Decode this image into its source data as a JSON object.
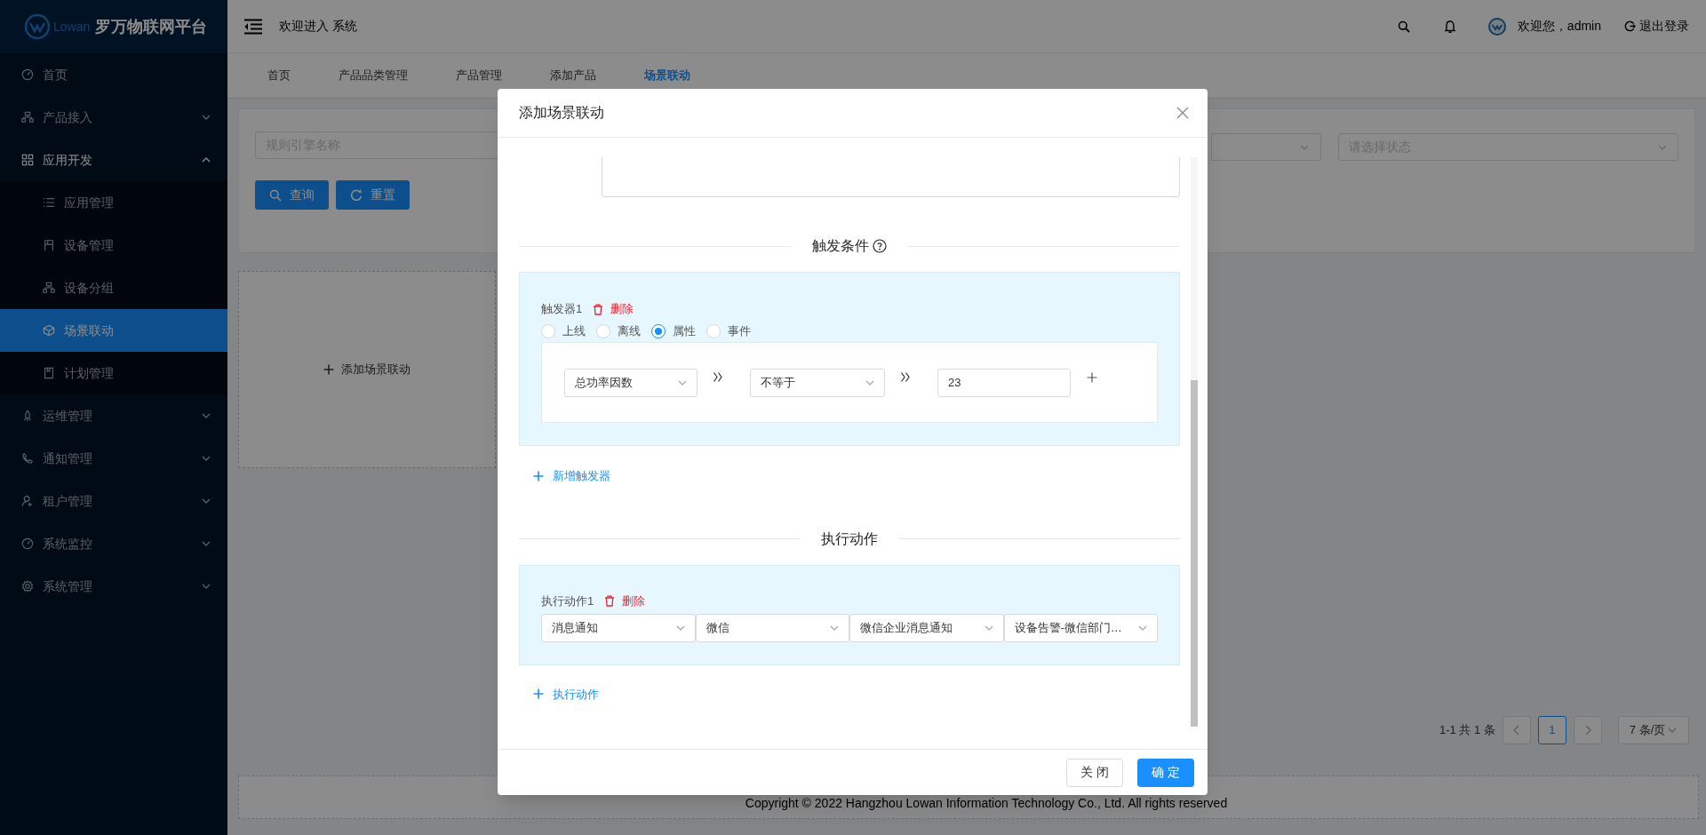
{
  "sidebar": {
    "logo_text": "Lowan",
    "title": "罗万物联网平台",
    "items": [
      {
        "label": "首页"
      },
      {
        "label": "产品接入",
        "expanded": false
      },
      {
        "label": "应用开发",
        "expanded": true,
        "children": [
          {
            "label": "应用管理",
            "selected": false
          },
          {
            "label": "设备管理",
            "selected": false
          },
          {
            "label": "设备分组",
            "selected": false
          },
          {
            "label": "场景联动",
            "selected": true
          },
          {
            "label": "计划管理",
            "selected": false
          }
        ]
      },
      {
        "label": "运维管理",
        "expanded": false
      },
      {
        "label": "通知管理",
        "expanded": false
      },
      {
        "label": "租户管理",
        "expanded": false
      },
      {
        "label": "系统监控",
        "expanded": false
      },
      {
        "label": "系统管理",
        "expanded": false
      }
    ]
  },
  "header": {
    "welcome": "欢迎进入 系统",
    "user_greeting": "欢迎您，admin",
    "logout": "退出登录"
  },
  "tabs": [
    {
      "label": "首页",
      "selected": false
    },
    {
      "label": "产品品类管理",
      "selected": false
    },
    {
      "label": "产品管理",
      "selected": false
    },
    {
      "label": "添加产品",
      "selected": false
    },
    {
      "label": "场景联动",
      "selected": true
    }
  ],
  "filters": {
    "name_placeholder": "规则引擎名称",
    "status_placeholder": "请选择状态",
    "buttons": [
      "查询",
      "重置"
    ]
  },
  "add_card": "添加场景联动",
  "pagination": {
    "summary": "1-1 共 1 条",
    "pages": [
      {
        "label": "1",
        "selected": true
      }
    ],
    "page_size": "7 条/页"
  },
  "footer": "Copyright © 2022 Hangzhou Lowan Information Technology Co., Ltd. All rights reserved",
  "dialog": {
    "title": "添加场景联动",
    "trigger_heading": "触发条件",
    "triggers": [
      {
        "label": "触发器1",
        "delete": "删除",
        "types": [
          {
            "label": "上线",
            "selected": false
          },
          {
            "label": "离线",
            "selected": false
          },
          {
            "label": "属性",
            "selected": true
          },
          {
            "label": "事件",
            "selected": false
          }
        ],
        "conditions": [
          {
            "property": "总功率因数",
            "operator": "不等于",
            "value": "23"
          }
        ]
      }
    ],
    "add_trigger": "新增触发器",
    "action_heading": "执行动作",
    "actions": [
      {
        "label": "执行动作1",
        "delete": "删除",
        "selects": [
          "消息通知",
          "微信",
          "微信企业消息通知",
          "设备告警-微信部门…"
        ]
      }
    ],
    "add_action": "执行动作",
    "buttons": [
      "关 闭",
      "确 定"
    ]
  }
}
